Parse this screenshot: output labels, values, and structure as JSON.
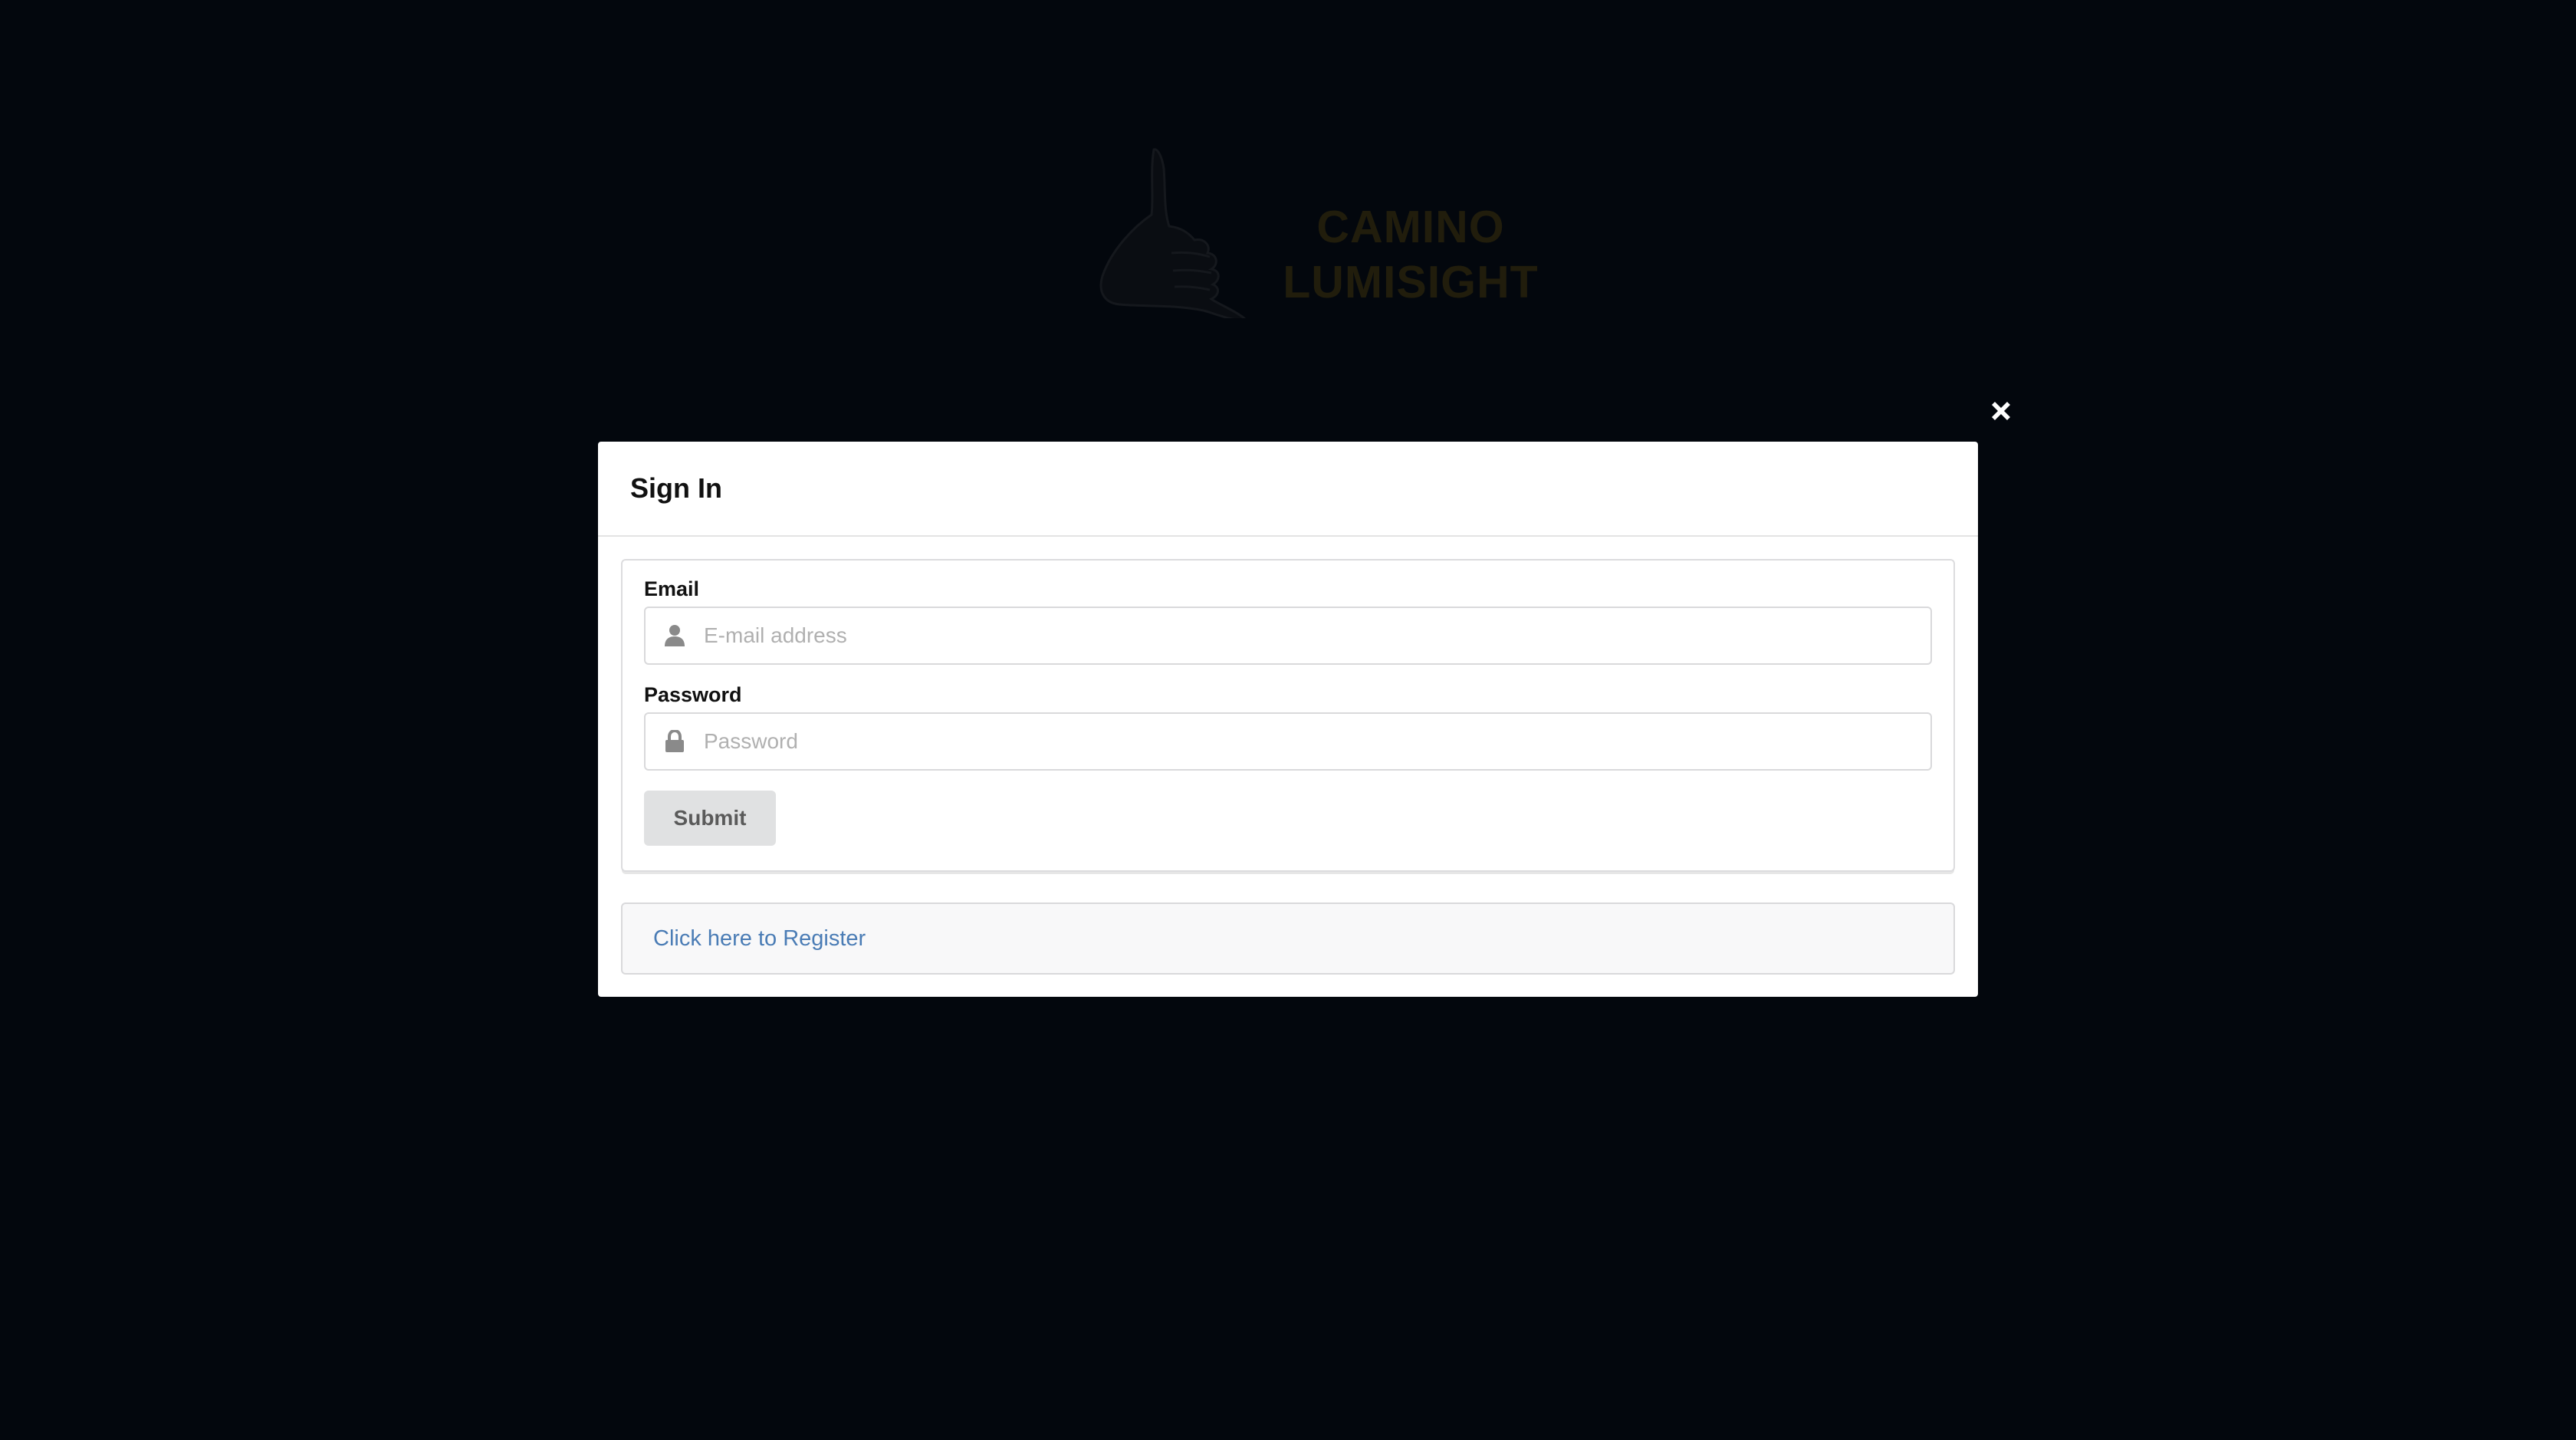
{
  "logo": {
    "line1": "CAMINO",
    "line2": "LUMISIGHT",
    "icon": "shaka-hand-icon"
  },
  "modal": {
    "title": "Sign In",
    "close_icon": "close-icon",
    "email": {
      "label": "Email",
      "placeholder": "E-mail address",
      "value": "",
      "icon": "user-icon"
    },
    "password": {
      "label": "Password",
      "placeholder": "Password",
      "value": "",
      "icon": "lock-icon"
    },
    "submit_label": "Submit",
    "register_label": "Click here to Register"
  },
  "colors": {
    "backdrop": "#03070d",
    "link": "#4a7cb5",
    "button_bg": "#e0e1e2"
  }
}
